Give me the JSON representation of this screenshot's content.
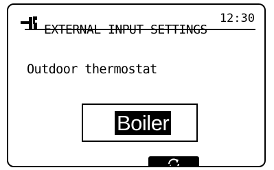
{
  "header": {
    "icon": "maintenance-wrench-icon",
    "time": "12:30",
    "title": "EXTERNAL INPUT SETTINGS"
  },
  "setting": {
    "label": "Outdoor thermostat",
    "value": "Boiler"
  },
  "softkeys": [
    {
      "icon": "cycle-arrows-icon"
    }
  ]
}
